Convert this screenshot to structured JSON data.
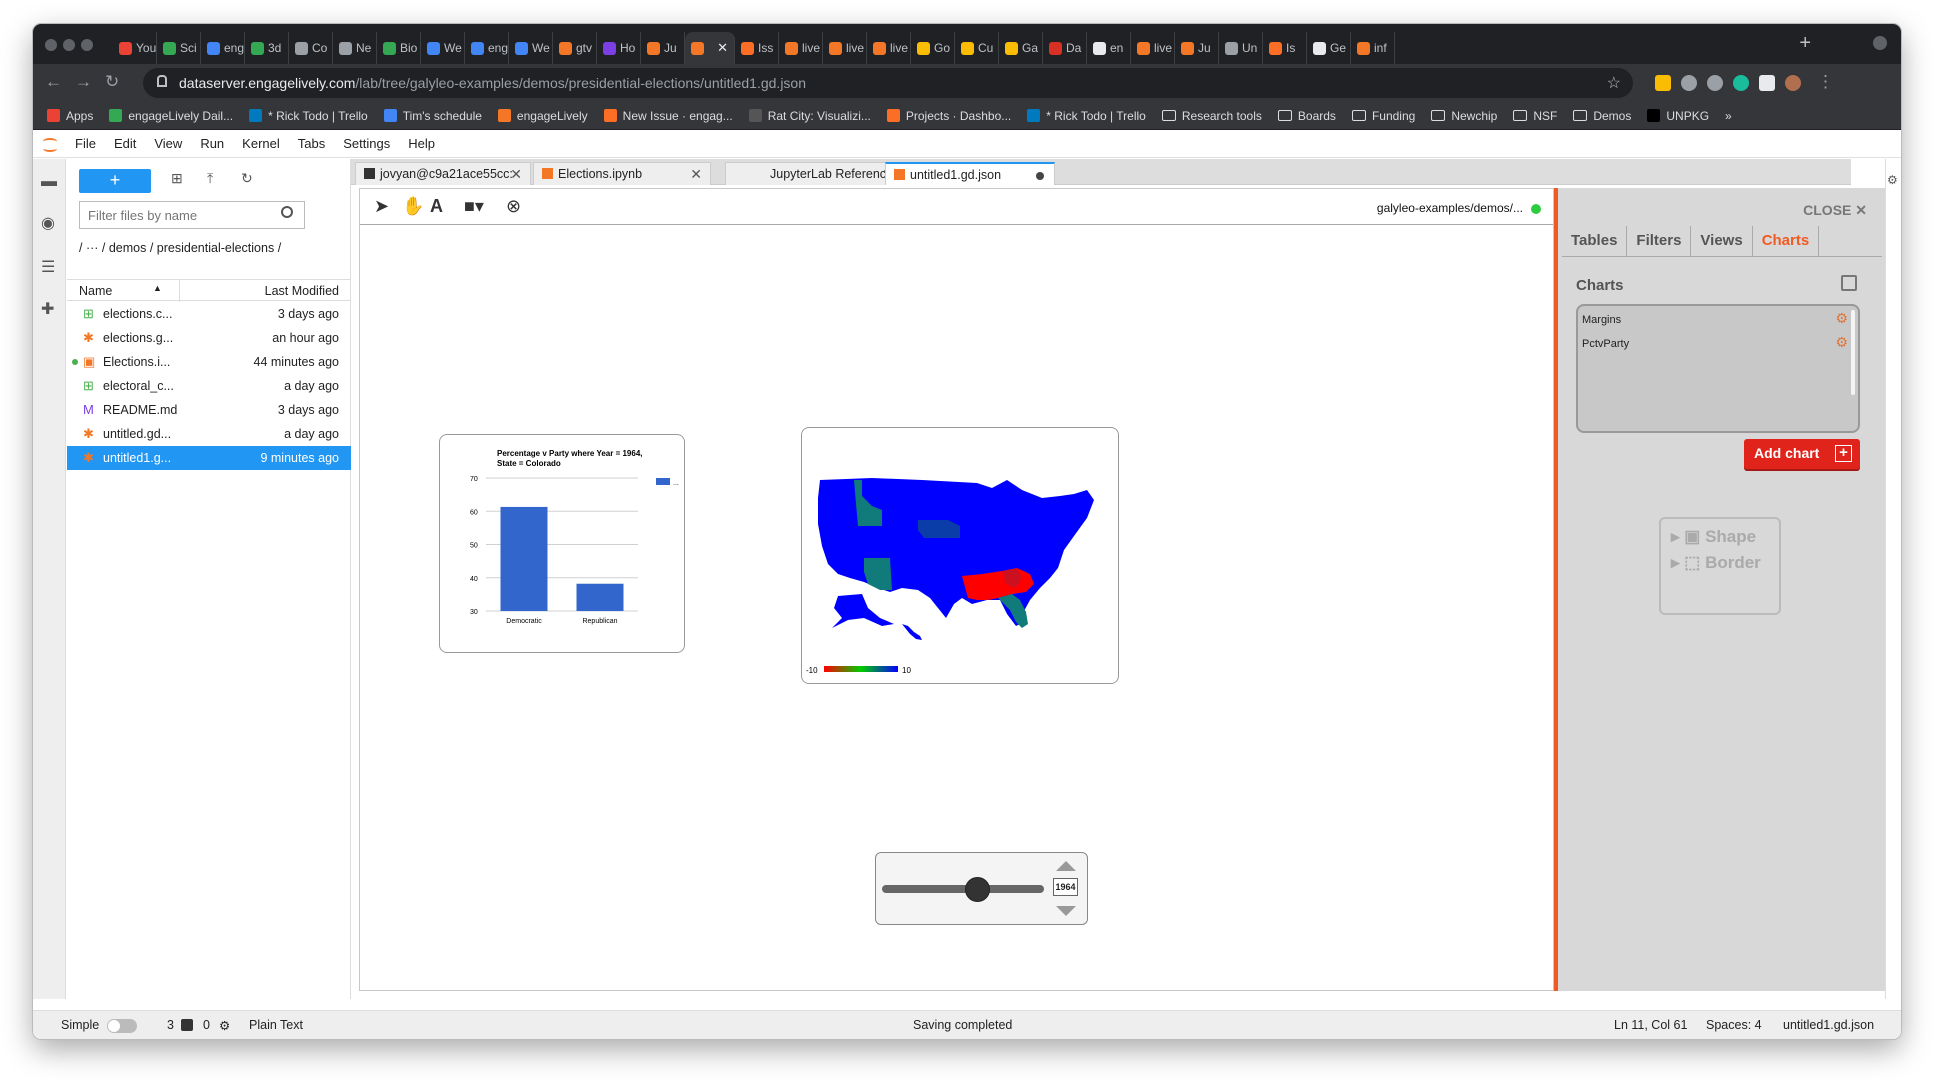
{
  "browser": {
    "tabs": [
      {
        "label": "You",
        "color": "#ea4335"
      },
      {
        "label": "Sci",
        "color": "#34a853"
      },
      {
        "label": "eng",
        "color": "#4285f4"
      },
      {
        "label": "3d",
        "color": "#34a853"
      },
      {
        "label": "Co",
        "color": "#9aa0a6"
      },
      {
        "label": "Ne",
        "color": "#9aa0a6"
      },
      {
        "label": "Bio",
        "color": "#34a853"
      },
      {
        "label": "We",
        "color": "#4285f4"
      },
      {
        "label": "eng",
        "color": "#4285f4"
      },
      {
        "label": "We",
        "color": "#4285f4"
      },
      {
        "label": "gtv",
        "color": "#f37726"
      },
      {
        "label": "Ho",
        "color": "#7b3fe4"
      },
      {
        "label": "Ju",
        "color": "#f37726"
      },
      {
        "label": "",
        "color": "#f37726",
        "active": true
      },
      {
        "label": "Iss",
        "color": "#fc6d26"
      },
      {
        "label": "live",
        "color": "#f37726"
      },
      {
        "label": "live",
        "color": "#f37726"
      },
      {
        "label": "live",
        "color": "#f37726"
      },
      {
        "label": "Go",
        "color": "#fbbc04"
      },
      {
        "label": "Cu",
        "color": "#fbbc04"
      },
      {
        "label": "Ga",
        "color": "#fbbc04"
      },
      {
        "label": "Da",
        "color": "#d93025"
      },
      {
        "label": "en",
        "color": "#e8eaed"
      },
      {
        "label": "live",
        "color": "#f37726"
      },
      {
        "label": "Ju",
        "color": "#f37726"
      },
      {
        "label": "Un",
        "color": "#9aa0a6"
      },
      {
        "label": "Is",
        "color": "#fc6d26"
      },
      {
        "label": "Ge",
        "color": "#e8eaed"
      },
      {
        "label": "inf",
        "color": "#f37726"
      }
    ],
    "url_host": "dataserver.engagelively.com",
    "url_path": "/lab/tree/galyleo-examples/demos/presidential-elections/untitled1.gd.json",
    "bookmarks": [
      {
        "label": "Apps",
        "type": "icon",
        "color": "#ea4335"
      },
      {
        "label": "engageLively Dail...",
        "type": "icon",
        "color": "#34a853"
      },
      {
        "label": "* Rick Todo | Trello",
        "type": "icon",
        "color": "#0079bf"
      },
      {
        "label": "Tim's schedule",
        "type": "icon",
        "color": "#4285f4"
      },
      {
        "label": "engageLively",
        "type": "icon",
        "color": "#f37726"
      },
      {
        "label": "New Issue · engag...",
        "type": "icon",
        "color": "#fc6d26"
      },
      {
        "label": "Rat City: Visualizi...",
        "type": "icon",
        "color": "#555555"
      },
      {
        "label": "Projects · Dashbo...",
        "type": "icon",
        "color": "#fc6d26"
      },
      {
        "label": "* Rick Todo | Trello",
        "type": "icon",
        "color": "#0079bf"
      },
      {
        "label": "Research tools",
        "type": "folder"
      },
      {
        "label": "Boards",
        "type": "folder"
      },
      {
        "label": "Funding",
        "type": "folder"
      },
      {
        "label": "Newchip",
        "type": "folder"
      },
      {
        "label": "NSF",
        "type": "folder"
      },
      {
        "label": "Demos",
        "type": "folder"
      },
      {
        "label": "UNPKG",
        "type": "icon",
        "color": "#000000"
      }
    ]
  },
  "jupyter": {
    "menu": [
      "File",
      "Edit",
      "View",
      "Run",
      "Kernel",
      "Tabs",
      "Settings",
      "Help"
    ],
    "filter_placeholder": "Filter files by name",
    "breadcrumb": "/   ···   / demos / presidential-elections /",
    "columns": {
      "name": "Name",
      "modified": "Last Modified"
    },
    "files": [
      {
        "name": "elections.c...",
        "modified": "3 days ago",
        "icon": "table",
        "color": "#4caf50"
      },
      {
        "name": "elections.g...",
        "modified": "an hour ago",
        "icon": "star",
        "color": "#f37726"
      },
      {
        "name": "Elections.i...",
        "modified": "44 minutes ago",
        "icon": "notebook",
        "color": "#f37726",
        "running": true
      },
      {
        "name": "electoral_c...",
        "modified": "a day ago",
        "icon": "table",
        "color": "#4caf50"
      },
      {
        "name": "README.md",
        "modified": "3 days ago",
        "icon": "md",
        "color": "#7b3fe4"
      },
      {
        "name": "untitled.gd...",
        "modified": "a day ago",
        "icon": "star",
        "color": "#f37726"
      },
      {
        "name": "untitled1.g...",
        "modified": "9 minutes ago",
        "icon": "star",
        "color": "#f37726",
        "selected": true
      }
    ],
    "main_tabs": [
      {
        "label": "jovyan@c9a21ace55cc: ~/g"
      },
      {
        "label": "Elections.ipynb"
      },
      {
        "label": "JupyterLab Reference"
      },
      {
        "label": "untitled1.gd.json",
        "active": true
      }
    ],
    "dashboard_path": "galyleo-examples/demos/...",
    "status": {
      "mode": "Simple",
      "terminals": "3",
      "kernels": "0",
      "file_type": "Plain Text",
      "message": "Saving completed",
      "cursor": "Ln 11, Col 61",
      "spaces": "Spaces: 4",
      "filename": "untitled1.gd.json"
    }
  },
  "side_panel": {
    "close_label": "CLOSE",
    "tabs": [
      "Tables",
      "Filters",
      "Views",
      "Charts"
    ],
    "active_tab": "Charts",
    "charts_title": "Charts",
    "charts": [
      "Margins",
      "PctvParty"
    ],
    "add_label": "Add chart",
    "shape_label": "Shape",
    "border_label": "Border"
  },
  "slider": {
    "value": "1964",
    "fraction": 0.59
  },
  "map": {
    "legend_min": "-10",
    "legend_max": "10",
    "colors": {
      "blue": "#0000ff",
      "red": "#ff0000",
      "teal": "#117a7a",
      "navy": "#0b3da8",
      "green": "#00cc00"
    }
  },
  "chart_data": {
    "type": "bar",
    "title": "Percentage v Party where Year = 1964,",
    "subtitle": "State = Colorado",
    "categories": [
      "Democratic",
      "Republican"
    ],
    "values": [
      61.3,
      38.2
    ],
    "ylim": [
      30,
      70
    ],
    "yticks": [
      30,
      40,
      50,
      60,
      70
    ],
    "legend": "...",
    "bar_color": "#3366cc",
    "grid": true
  }
}
